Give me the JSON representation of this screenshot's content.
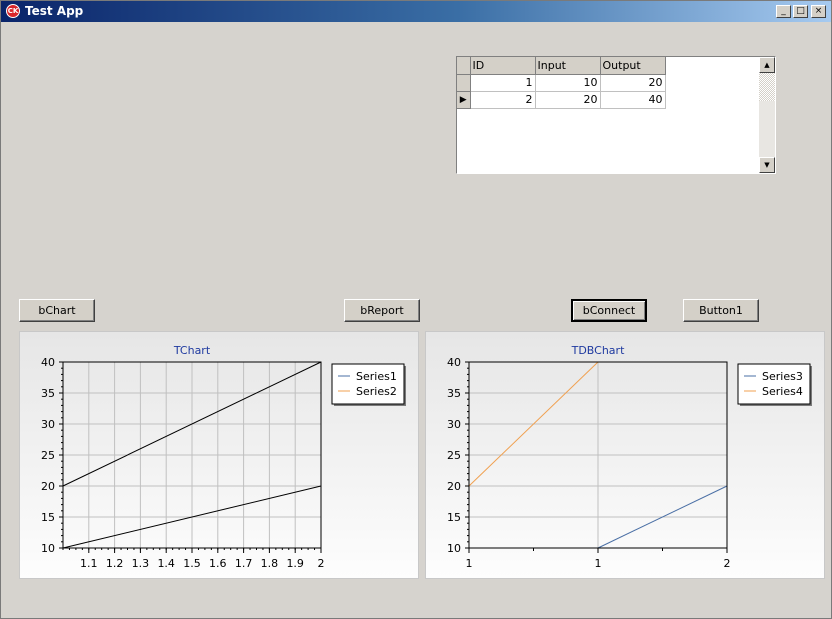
{
  "window": {
    "title": "Test App",
    "icon": "app-icon",
    "controls": {
      "minimize": "_",
      "maximize": "□",
      "close": "×"
    }
  },
  "buttons": {
    "chart": "bChart",
    "report": "bReport",
    "connect": "bConnect",
    "button1": "Button1"
  },
  "grid": {
    "columns": [
      "ID",
      "Input",
      "Output"
    ],
    "rows": [
      [
        "1",
        "10",
        "20"
      ],
      [
        "2",
        "20",
        "40"
      ]
    ],
    "current_row_indicator": "▶",
    "scroll_up": "▲",
    "scroll_down": "▼"
  },
  "charts": {
    "tchart_title": "TChart",
    "tdbchart_title": "TDBChart",
    "legend_left": [
      "Series1",
      "Series2"
    ],
    "legend_right": [
      "Series3",
      "Series4"
    ],
    "y_ticks": [
      "40",
      "35",
      "30",
      "25",
      "20",
      "15",
      "10"
    ],
    "x_ticks_left": [
      "1.1",
      "1.2",
      "1.3",
      "1.4",
      "1.5",
      "1.6",
      "1.7",
      "1.8",
      "1.9",
      "2"
    ],
    "x_ticks_right": [
      "1",
      "1",
      "2"
    ]
  },
  "colors": {
    "series1": "#4a6fa5",
    "series2": "#f0a050",
    "axis_title": "#1f3aa0"
  },
  "chart_data": [
    {
      "type": "line",
      "title": "TChart",
      "x": [
        1,
        2
      ],
      "series": [
        {
          "name": "Series1",
          "values": [
            10,
            20
          ]
        },
        {
          "name": "Series2",
          "values": [
            20,
            40
          ]
        }
      ],
      "xlim": [
        1,
        2
      ],
      "ylim": [
        10,
        40
      ],
      "grid": true,
      "legend": "top-right"
    },
    {
      "type": "line",
      "title": "TDBChart",
      "x_categories": [
        "1",
        "1",
        "2"
      ],
      "series": [
        {
          "name": "Series3",
          "points": [
            [
              1,
              10
            ],
            [
              2,
              20
            ]
          ]
        },
        {
          "name": "Series4",
          "points": [
            [
              0,
              20
            ],
            [
              1,
              40
            ]
          ]
        }
      ],
      "ylim": [
        10,
        40
      ],
      "grid": true,
      "legend": "top-right"
    }
  ]
}
